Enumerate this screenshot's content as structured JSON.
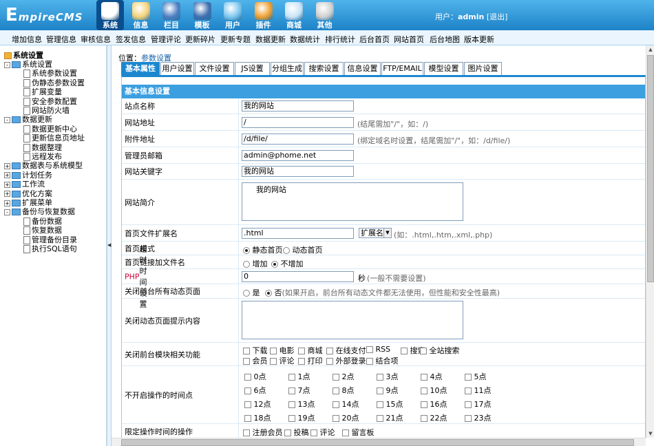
{
  "header": {
    "logo": "EmpireCMS",
    "user_label": "用户：",
    "user_name": "admin",
    "logout": "[退出]",
    "nav": [
      {
        "label": "系统",
        "icon": "globe-icon",
        "active": true
      },
      {
        "label": "信息",
        "icon": "notepad-icon"
      },
      {
        "label": "栏目",
        "icon": "folder-icon"
      },
      {
        "label": "模板",
        "icon": "template-icon"
      },
      {
        "label": "用户",
        "icon": "user-icon"
      },
      {
        "label": "插件",
        "icon": "tools-icon"
      },
      {
        "label": "商城",
        "icon": "shop-icon"
      },
      {
        "label": "其他",
        "icon": "gear-icon"
      }
    ]
  },
  "menu": [
    "增加信息",
    "管理信息",
    "审核信息",
    "签发信息",
    "管理评论",
    "更新碎片",
    "更新专题",
    "数据更新",
    "数据统计",
    "排行统计",
    "后台首页",
    "网站首页",
    "后台地图",
    "版本更新"
  ],
  "tree": {
    "root": "系统设置",
    "nodes": [
      {
        "label": "系统设置",
        "kind": "folder",
        "expand": "-"
      },
      {
        "label": "系统参数设置",
        "kind": "page"
      },
      {
        "label": "伪静态参数设置",
        "kind": "page"
      },
      {
        "label": "扩展变量",
        "kind": "page"
      },
      {
        "label": "安全参数配置",
        "kind": "page"
      },
      {
        "label": "网站防火墙",
        "kind": "page"
      },
      {
        "label": "数据更新",
        "kind": "folder",
        "expand": "-"
      },
      {
        "label": "数据更新中心",
        "kind": "page"
      },
      {
        "label": "更新信息页地址",
        "kind": "page"
      },
      {
        "label": "数据整理",
        "kind": "page"
      },
      {
        "label": "远程发布",
        "kind": "page"
      },
      {
        "label": "数据表与系统模型",
        "kind": "folder",
        "expand": "+"
      },
      {
        "label": "计划任务",
        "kind": "folder",
        "expand": "+"
      },
      {
        "label": "工作流",
        "kind": "folder",
        "expand": "+"
      },
      {
        "label": "优化方案",
        "kind": "folder",
        "expand": "+"
      },
      {
        "label": "扩展菜单",
        "kind": "folder",
        "expand": "+"
      },
      {
        "label": "备份与恢复数据",
        "kind": "folder",
        "expand": "-"
      },
      {
        "label": "备份数据",
        "kind": "page"
      },
      {
        "label": "恢复数据",
        "kind": "page"
      },
      {
        "label": "管理备份目录",
        "kind": "page"
      },
      {
        "label": "执行SQL语句",
        "kind": "page"
      }
    ]
  },
  "crumb": {
    "label": "位置：",
    "link": "参数设置"
  },
  "tabs": [
    "基本属性",
    "用户设置",
    "文件设置",
    "JS设置",
    "分组生成",
    "搜索设置",
    "信息设置",
    "FTP/EMAIL",
    "模型设置",
    "图片设置"
  ],
  "form": {
    "section_title": "基本信息设置",
    "site_name_label": "站点名称",
    "site_name": "我的网站",
    "site_url_label": "网站地址",
    "site_url": "/",
    "site_url_hint": "(结尾需加\"/\"，如：/)",
    "attach_url_label": "附件地址",
    "attach_url": "/d/file/",
    "attach_url_hint": "(绑定域名时设置，结尾需加\"/\"，如：/d/file/)",
    "email_label": "管理员邮箱",
    "email": "admin@phome.net",
    "keywords_label": "网站关键字",
    "keywords": "我的网站",
    "intro_label": "网站简介",
    "intro": "我的网站",
    "index_ext_label": "首页文件扩展名",
    "index_ext": ".html",
    "ext_select": "扩展名",
    "index_ext_hint": "(如：.html,.htm,.xml,.php)",
    "index_mode_label": "首页模式",
    "index_mode_static": "静态首页",
    "index_mode_dynamic": "动态首页",
    "index_link_label": "首页链接加文件名",
    "index_link_yes": "增加",
    "index_link_no": "不增加",
    "php_timeout_label_prefix": "PHP",
    "php_timeout_label": "超时时间设置",
    "php_timeout": "0",
    "php_timeout_unit": "秒",
    "php_timeout_hint": "(一般不需要设置)",
    "close_dynamic_label": "关闭前台所有动态页面",
    "close_yes": "是",
    "close_no": "否",
    "close_hint": "(如果开启，前台所有动态文件都无法使用，但性能和安全性最高)",
    "close_tip_label": "关闭动态页面提示内容",
    "close_modules_label": "关闭前台模块相关功能",
    "modules_row1": [
      "下载",
      "电影",
      "商城",
      "在线支付",
      "RSS",
      "搜索",
      "全站搜索"
    ],
    "modules_row2": [
      "会员",
      "评论",
      "打印",
      "外部登录",
      "结合项"
    ],
    "noop_hours_label": "不开启操作的时间点",
    "hours": [
      "0点",
      "1点",
      "2点",
      "3点",
      "4点",
      "5点",
      "6点",
      "7点",
      "8点",
      "9点",
      "10点",
      "11点",
      "12点",
      "13点",
      "14点",
      "15点",
      "16点",
      "17点",
      "18点",
      "19点",
      "20点",
      "21点",
      "22点",
      "23点"
    ],
    "limit_ops_label": "限定操作时间的操作",
    "limit_ops": [
      "注册会员",
      "投稿",
      "评论",
      "留言板"
    ]
  },
  "colors": {
    "header_top": "#4fb4ea",
    "header_bottom": "#1d82c8",
    "tab_active": "#1c87cf",
    "section": "#3b9fe0"
  }
}
